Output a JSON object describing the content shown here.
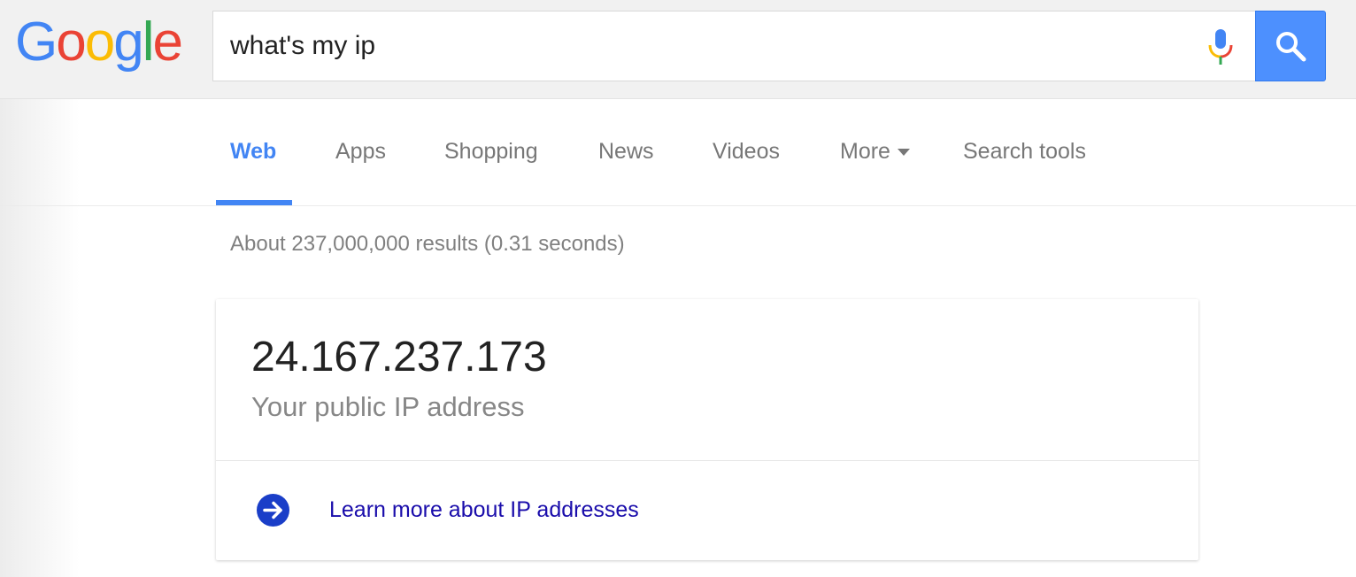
{
  "header": {
    "logo_letters": [
      "G",
      "o",
      "o",
      "g",
      "l",
      "e"
    ],
    "logo_colors": [
      "#4285f4",
      "#ea4335",
      "#fbbc05",
      "#4285f4",
      "#34a853",
      "#ea4335"
    ],
    "search": {
      "value": "what's my ip",
      "placeholder": ""
    },
    "icons": {
      "mic": "microphone-icon",
      "search": "search-icon"
    }
  },
  "tabs": [
    {
      "label": "Web",
      "active": true
    },
    {
      "label": "Apps",
      "active": false
    },
    {
      "label": "Shopping",
      "active": false
    },
    {
      "label": "News",
      "active": false
    },
    {
      "label": "Videos",
      "active": false
    },
    {
      "label": "More",
      "active": false,
      "icon": "caret-down-icon"
    },
    {
      "label": "Search tools",
      "active": false
    }
  ],
  "result_stats": "About 237,000,000 results (0.31 seconds)",
  "ip_card": {
    "ip": "24.167.237.173",
    "label": "Your public IP address",
    "learn_more": "Learn more about IP addresses",
    "learn_more_icon": "arrow-right-circle-icon"
  },
  "colors": {
    "accent": "#4285f4",
    "link": "#1a0dab",
    "search_button": "#4d90fe"
  }
}
